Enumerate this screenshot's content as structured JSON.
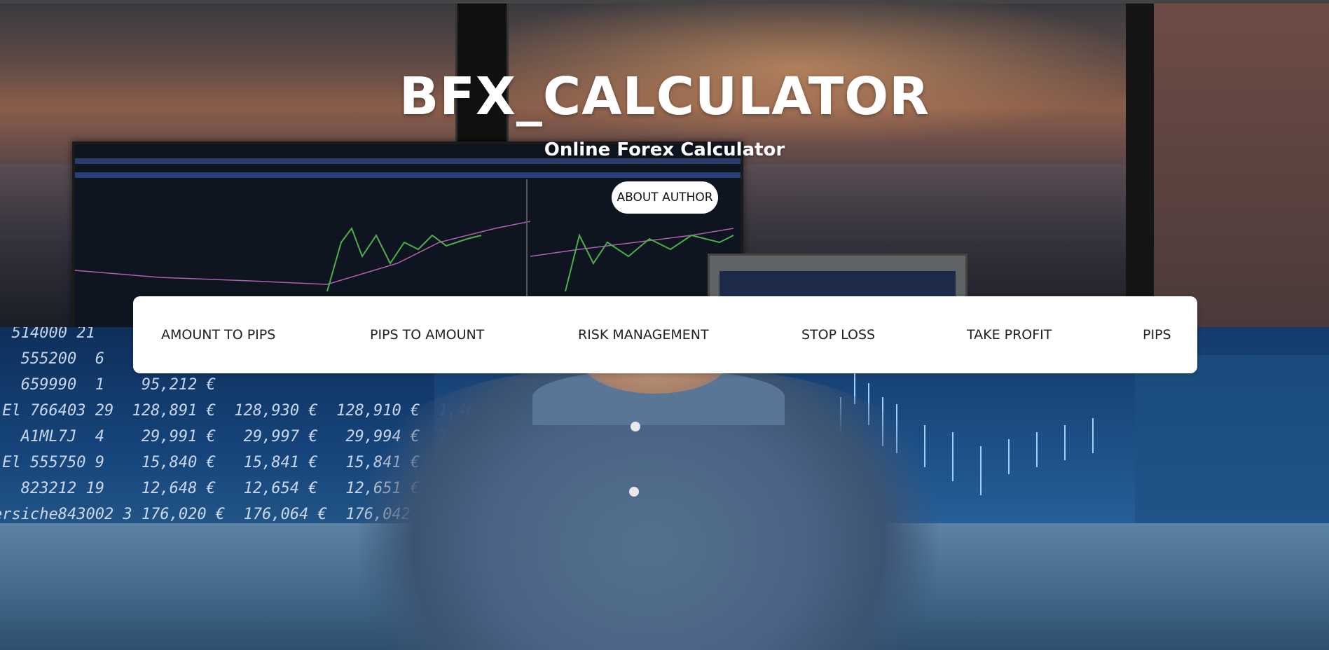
{
  "header": {
    "title": "BFX_CALCULATOR",
    "subtitle": "Online Forex Calculator",
    "about_button": "ABOUT AUTHOR"
  },
  "nav": {
    "items": [
      {
        "label": "AMOUNT TO PIPS"
      },
      {
        "label": "PIPS TO AMOUNT"
      },
      {
        "label": "RISK MANAGEMENT"
      },
      {
        "label": "STOP LOSS"
      },
      {
        "label": "TAKE PROFIT"
      },
      {
        "label": "PIPS"
      }
    ]
  },
  "colors": {
    "title_text": "#ffffff",
    "nav_background": "#ffffff",
    "nav_text": "#222222"
  }
}
